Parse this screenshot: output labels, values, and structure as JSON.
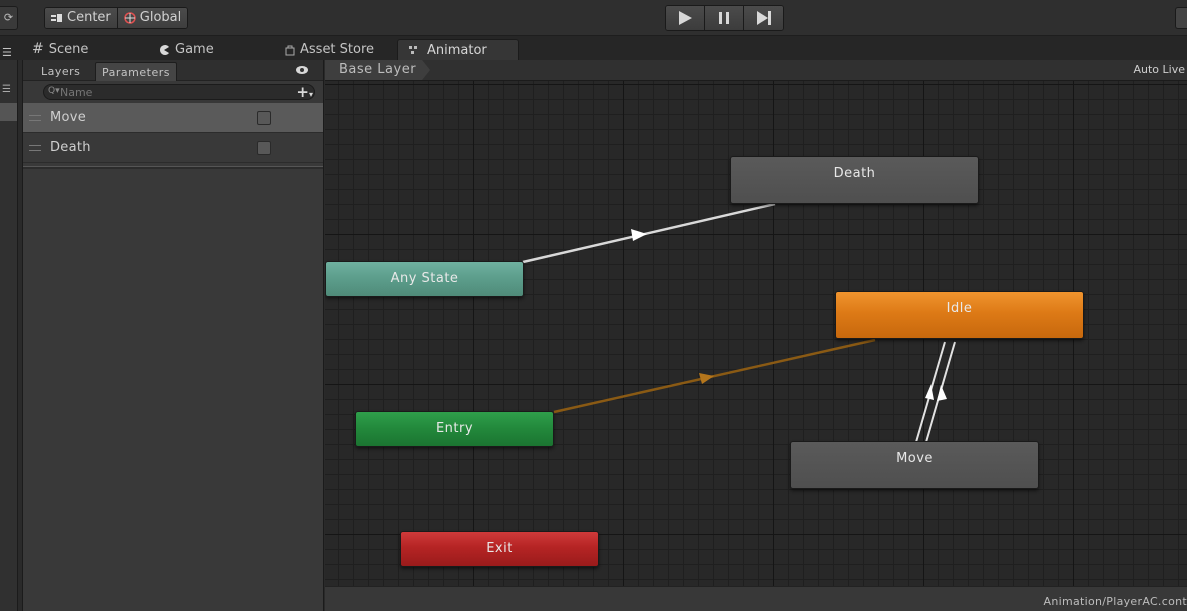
{
  "toolbar": {
    "pivot_label": "Center",
    "space_label": "Global",
    "play_controls": [
      "play-icon",
      "pause-icon",
      "step-icon"
    ]
  },
  "tabs": [
    {
      "label": "Scene",
      "icon": "grid-icon"
    },
    {
      "label": "Game",
      "icon": "pacman-icon"
    },
    {
      "label": "Asset Store",
      "icon": "bag-icon"
    },
    {
      "label": "Animator",
      "icon": "animator-icon",
      "active": true
    }
  ],
  "parameters_panel": {
    "tabs": [
      "Layers",
      "Parameters"
    ],
    "active_tab": "Parameters",
    "search_placeholder": "Name",
    "params": [
      {
        "name": "Move",
        "type": "bool",
        "value": false,
        "selected": true
      },
      {
        "name": "Death",
        "type": "bool",
        "value": false,
        "selected": false
      }
    ]
  },
  "graph": {
    "breadcrumb": "Base Layer",
    "auto_live": "Auto Live",
    "status_path": "Animation/PlayerAC.cont",
    "states": {
      "any_state": "Any State",
      "entry": "Entry",
      "exit": "Exit",
      "idle": "Idle",
      "move": "Move",
      "death": "Death"
    },
    "default_state": "Idle",
    "transitions": [
      {
        "from": "Any State",
        "to": "Death"
      },
      {
        "from": "Entry",
        "to": "Idle",
        "default": true
      },
      {
        "from": "Idle",
        "to": "Move"
      },
      {
        "from": "Move",
        "to": "Idle"
      }
    ],
    "colors": {
      "any_state": "#5d9e8c",
      "entry": "#238a3c",
      "exit": "#b52424",
      "default_state": "#dd7a16",
      "state": "#555555",
      "transition": "#d9d9d9",
      "entry_transition": "#8a5a14"
    }
  }
}
